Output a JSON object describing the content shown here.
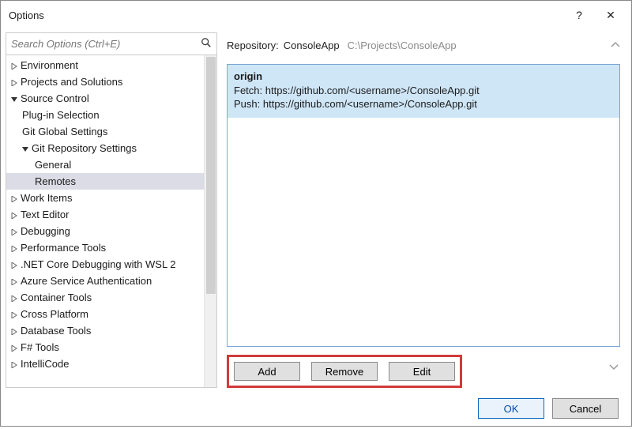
{
  "window": {
    "title": "Options",
    "help": "?",
    "close": "✕"
  },
  "search": {
    "placeholder": "Search Options (Ctrl+E)"
  },
  "tree": {
    "items": [
      {
        "label": "Environment"
      },
      {
        "label": "Projects and Solutions"
      },
      {
        "label": "Source Control"
      },
      {
        "label": "Plug-in Selection"
      },
      {
        "label": "Git Global Settings"
      },
      {
        "label": "Git Repository Settings"
      },
      {
        "label": "General"
      },
      {
        "label": "Remotes"
      },
      {
        "label": "Work Items"
      },
      {
        "label": "Text Editor"
      },
      {
        "label": "Debugging"
      },
      {
        "label": "Performance Tools"
      },
      {
        "label": ".NET Core Debugging with WSL 2"
      },
      {
        "label": "Azure Service Authentication"
      },
      {
        "label": "Container Tools"
      },
      {
        "label": "Cross Platform"
      },
      {
        "label": "Database Tools"
      },
      {
        "label": "F# Tools"
      },
      {
        "label": "IntelliCode"
      }
    ]
  },
  "repo": {
    "key": "Repository:",
    "name": "ConsoleApp",
    "path": "C:\\Projects\\ConsoleApp"
  },
  "remote": {
    "name": "origin",
    "fetch_label": "Fetch:",
    "fetch_url": "https://github.com/<username>/ConsoleApp.git",
    "push_label": "Push:",
    "push_url": "https://github.com/<username>/ConsoleApp.git"
  },
  "buttons": {
    "add": "Add",
    "remove": "Remove",
    "edit": "Edit"
  },
  "footer": {
    "ok": "OK",
    "cancel": "Cancel"
  }
}
